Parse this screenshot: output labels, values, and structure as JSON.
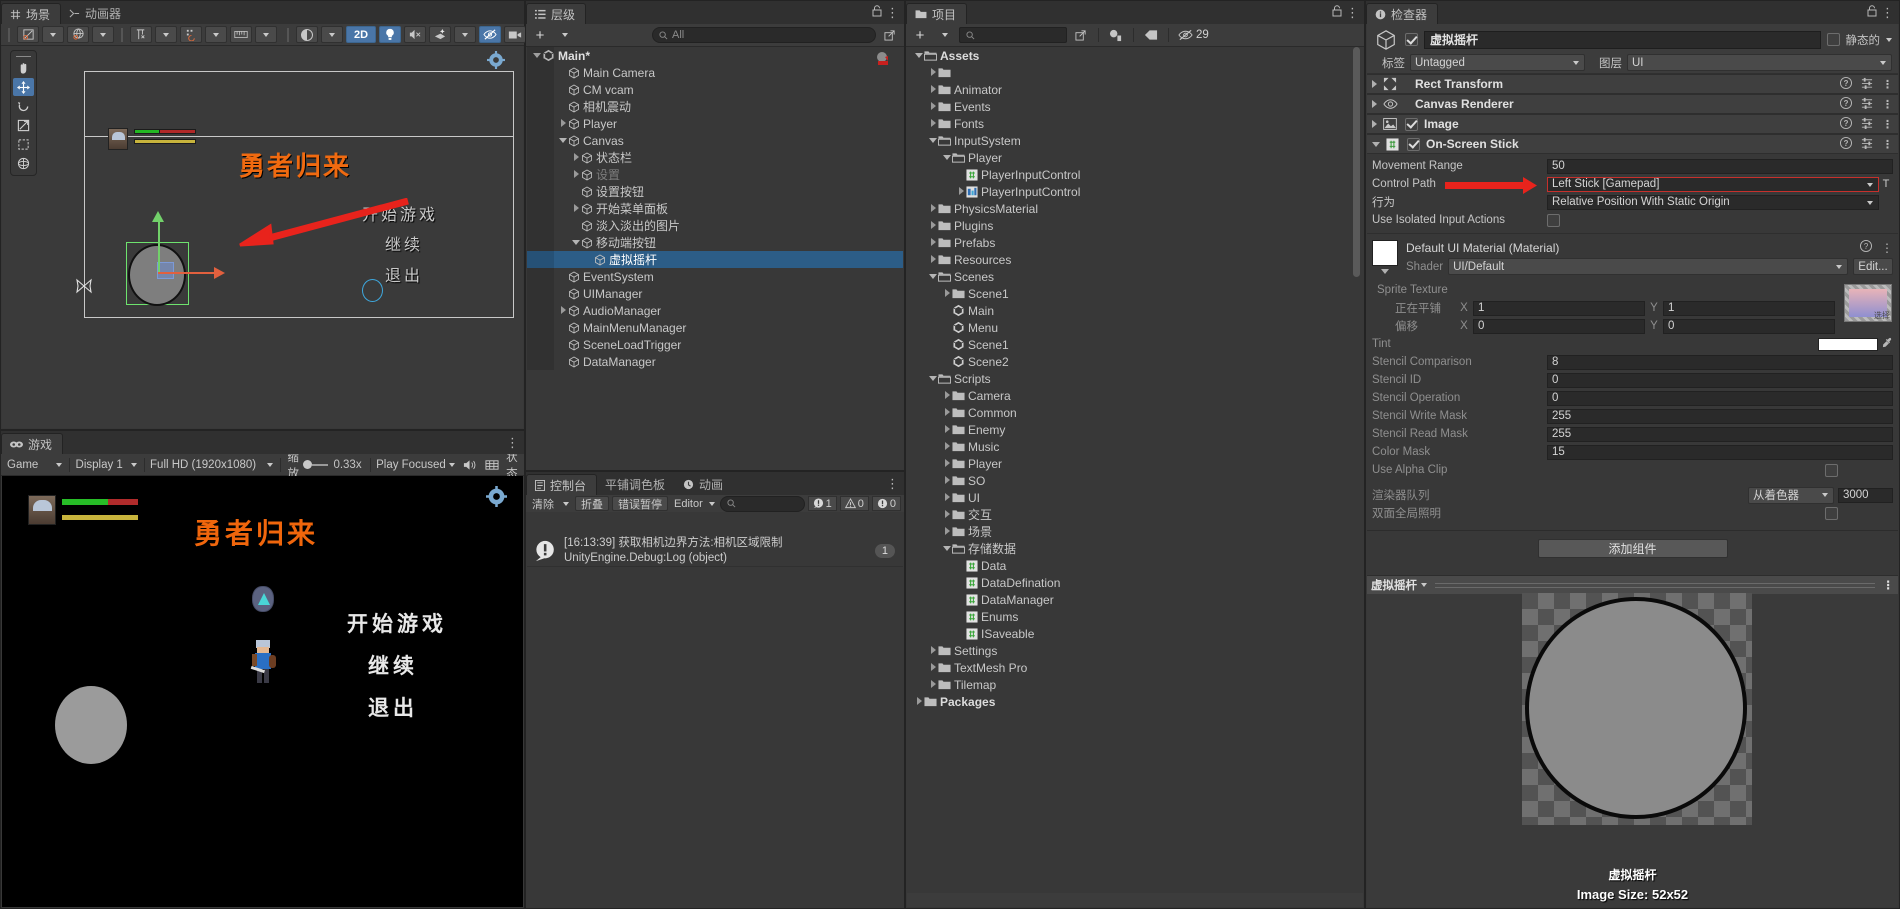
{
  "scene_panel": {
    "tabs": [
      {
        "label": "场景",
        "icon": "grid-icon",
        "active": true
      },
      {
        "label": "动画器",
        "icon": "animator-icon",
        "active": false
      }
    ],
    "toolbar": [
      {
        "name": "pivot-rotation-toggle",
        "icon": "pivot-icon",
        "dropdown": true,
        "on": false
      },
      {
        "name": "global-local-toggle",
        "icon": "globe-icon",
        "dropdown": true,
        "on": false
      },
      {
        "name": "grid-snap-toggle",
        "icon": "grid-snap-icon",
        "dropdown": true,
        "on": false
      },
      {
        "name": "vertex-snap-toggle",
        "icon": "vertex-snap-icon",
        "dropdown": true,
        "on": false
      },
      {
        "name": "ruler-icon",
        "icon": "ruler-icon",
        "dropdown": true,
        "on": false
      },
      {
        "name": "shading-mode",
        "icon": "shading-icon",
        "dropdown": true,
        "on": false
      },
      {
        "name": "2d-toggle",
        "label": "2D",
        "on": true
      },
      {
        "name": "lighting-toggle",
        "icon": "bulb-icon",
        "on": true
      },
      {
        "name": "audio-toggle",
        "icon": "mute-icon",
        "on": false
      },
      {
        "name": "effects-toggle",
        "icon": "fx-icon",
        "dropdown": true,
        "on": false
      },
      {
        "name": "hidden-objects-toggle",
        "icon": "eye-off-icon",
        "on": true
      },
      {
        "name": "camera-settings",
        "icon": "camera-icon",
        "dropdown": true,
        "on": false
      },
      {
        "name": "gizmos-toggle",
        "icon": "gizmo-icon",
        "dropdown": true,
        "on": true
      }
    ],
    "tools": [
      "hand-tool",
      "move-tool",
      "rotate-tool",
      "scale-tool",
      "rect-tool",
      "transform-tool"
    ],
    "selected_tool_index": 1,
    "game_title": "勇者归来",
    "menu_items": [
      "开始游戏",
      "继续",
      "退出"
    ]
  },
  "game_panel": {
    "tab": "游戏",
    "toolbar": {
      "mode": "Game",
      "display": "Display 1",
      "resolution": "Full HD (1920x1080)",
      "scale_label": "缩放",
      "scale_value": "0.33x",
      "play_mode": "Play Focused",
      "mute_icon": "speaker-icon",
      "stats_icon": "stats-icon",
      "gizmos_label": "状态"
    },
    "title": "勇者归来",
    "menu_items": [
      "开始游戏",
      "继续",
      "退出"
    ]
  },
  "hierarchy": {
    "tab": "层级",
    "add_label": "+",
    "search_placeholder": "All",
    "items": [
      {
        "label": "Main*",
        "depth": 0,
        "arrow": "down",
        "icon": "unity-icon",
        "bold": true,
        "selected": false,
        "dim": false
      },
      {
        "label": "Main Camera",
        "depth": 2,
        "arrow": "",
        "icon": "cube-icon",
        "selected": false,
        "dim": false
      },
      {
        "label": "CM vcam",
        "depth": 2,
        "arrow": "",
        "icon": "cube-icon",
        "selected": false,
        "dim": false
      },
      {
        "label": "相机震动",
        "depth": 2,
        "arrow": "",
        "icon": "cube-icon",
        "selected": false,
        "dim": false
      },
      {
        "label": "Player",
        "depth": 2,
        "arrow": "right",
        "icon": "cube-icon",
        "selected": false,
        "dim": false
      },
      {
        "label": "Canvas",
        "depth": 2,
        "arrow": "down",
        "icon": "cube-icon",
        "selected": false,
        "dim": false
      },
      {
        "label": "状态栏",
        "depth": 3,
        "arrow": "right",
        "icon": "cube-icon",
        "selected": false,
        "dim": false
      },
      {
        "label": "设置",
        "depth": 3,
        "arrow": "right",
        "icon": "cube-icon",
        "selected": false,
        "dim": true
      },
      {
        "label": "设置按钮",
        "depth": 3,
        "arrow": "",
        "icon": "cube-icon",
        "selected": false,
        "dim": false
      },
      {
        "label": "开始菜单面板",
        "depth": 3,
        "arrow": "right",
        "icon": "cube-icon",
        "selected": false,
        "dim": false
      },
      {
        "label": "淡入淡出的图片",
        "depth": 3,
        "arrow": "",
        "icon": "cube-icon",
        "selected": false,
        "dim": false
      },
      {
        "label": "移动端按钮",
        "depth": 3,
        "arrow": "down",
        "icon": "cube-icon",
        "selected": false,
        "dim": false
      },
      {
        "label": "虚拟摇杆",
        "depth": 4,
        "arrow": "",
        "icon": "cube-icon",
        "selected": true,
        "dim": false
      },
      {
        "label": "EventSystem",
        "depth": 2,
        "arrow": "",
        "icon": "cube-icon",
        "selected": false,
        "dim": false
      },
      {
        "label": "UIManager",
        "depth": 2,
        "arrow": "",
        "icon": "cube-icon",
        "selected": false,
        "dim": false
      },
      {
        "label": "AudioManager",
        "depth": 2,
        "arrow": "right",
        "icon": "cube-icon",
        "selected": false,
        "dim": false
      },
      {
        "label": "MainMenuManager",
        "depth": 2,
        "arrow": "",
        "icon": "cube-icon",
        "selected": false,
        "dim": false
      },
      {
        "label": "SceneLoadTrigger",
        "depth": 2,
        "arrow": "",
        "icon": "cube-icon",
        "selected": false,
        "dim": false
      },
      {
        "label": "DataManager",
        "depth": 2,
        "arrow": "",
        "icon": "cube-icon",
        "selected": false,
        "dim": false
      }
    ]
  },
  "console": {
    "tabs": [
      {
        "label": "控制台",
        "icon": "console-icon",
        "active": true
      },
      {
        "label": "平铺调色板",
        "icon": "",
        "active": false
      },
      {
        "label": "动画",
        "icon": "clock-icon",
        "active": false
      }
    ],
    "clear_label": "清除",
    "collapse_label": "折叠",
    "error_pause_label": "错误暂停",
    "editor_label": "Editor",
    "search_placeholder": "",
    "counts": {
      "error": "1",
      "warning": "0",
      "info": "0"
    },
    "log": {
      "line1": "[16:13:39] 获取相机边界方法:相机区域限制",
      "line2": "UnityEngine.Debug:Log (object)",
      "count": "1",
      "icon": "error-icon"
    }
  },
  "project": {
    "tab": "项目",
    "add_label": "+",
    "search_placeholder": "",
    "hidden_count": "29",
    "items": [
      {
        "label": "Assets",
        "depth": 0,
        "arrow": "down",
        "icon": "folder-open-icon",
        "bold": true
      },
      {
        "label": "",
        "depth": 1,
        "arrow": "right",
        "icon": "folder-icon",
        "bold": false
      },
      {
        "label": "Animator",
        "depth": 1,
        "arrow": "right",
        "icon": "folder-icon",
        "bold": false
      },
      {
        "label": "Events",
        "depth": 1,
        "arrow": "right",
        "icon": "folder-icon",
        "bold": false
      },
      {
        "label": "Fonts",
        "depth": 1,
        "arrow": "right",
        "icon": "folder-icon",
        "bold": false
      },
      {
        "label": "InputSystem",
        "depth": 1,
        "arrow": "down",
        "icon": "folder-open-icon",
        "bold": false
      },
      {
        "label": "Player",
        "depth": 2,
        "arrow": "down",
        "icon": "folder-open-icon",
        "bold": false
      },
      {
        "label": "PlayerInputControl",
        "depth": 3,
        "arrow": "",
        "icon": "cs-script-icon",
        "bold": false
      },
      {
        "label": "PlayerInputControl",
        "depth": 3,
        "arrow": "right",
        "icon": "inputactions-icon",
        "bold": false
      },
      {
        "label": "PhysicsMaterial",
        "depth": 1,
        "arrow": "right",
        "icon": "folder-icon",
        "bold": false
      },
      {
        "label": "Plugins",
        "depth": 1,
        "arrow": "right",
        "icon": "folder-icon",
        "bold": false
      },
      {
        "label": "Prefabs",
        "depth": 1,
        "arrow": "right",
        "icon": "folder-icon",
        "bold": false
      },
      {
        "label": "Resources",
        "depth": 1,
        "arrow": "right",
        "icon": "folder-icon",
        "bold": false
      },
      {
        "label": "Scenes",
        "depth": 1,
        "arrow": "down",
        "icon": "folder-open-icon",
        "bold": false
      },
      {
        "label": "Scene1",
        "depth": 2,
        "arrow": "right",
        "icon": "folder-icon",
        "bold": false
      },
      {
        "label": "Main",
        "depth": 2,
        "arrow": "",
        "icon": "unity-scene-icon",
        "bold": false
      },
      {
        "label": "Menu",
        "depth": 2,
        "arrow": "",
        "icon": "unity-scene-icon",
        "bold": false
      },
      {
        "label": "Scene1",
        "depth": 2,
        "arrow": "",
        "icon": "unity-scene-icon",
        "bold": false
      },
      {
        "label": "Scene2",
        "depth": 2,
        "arrow": "",
        "icon": "unity-scene-icon",
        "bold": false
      },
      {
        "label": "Scripts",
        "depth": 1,
        "arrow": "down",
        "icon": "folder-open-icon",
        "bold": false
      },
      {
        "label": "Camera",
        "depth": 2,
        "arrow": "right",
        "icon": "folder-icon",
        "bold": false
      },
      {
        "label": "Common",
        "depth": 2,
        "arrow": "right",
        "icon": "folder-icon",
        "bold": false
      },
      {
        "label": "Enemy",
        "depth": 2,
        "arrow": "right",
        "icon": "folder-icon",
        "bold": false
      },
      {
        "label": "Music",
        "depth": 2,
        "arrow": "right",
        "icon": "folder-icon",
        "bold": false
      },
      {
        "label": "Player",
        "depth": 2,
        "arrow": "right",
        "icon": "folder-icon",
        "bold": false
      },
      {
        "label": "SO",
        "depth": 2,
        "arrow": "right",
        "icon": "folder-icon",
        "bold": false
      },
      {
        "label": "UI",
        "depth": 2,
        "arrow": "right",
        "icon": "folder-icon",
        "bold": false
      },
      {
        "label": "交互",
        "depth": 2,
        "arrow": "right",
        "icon": "folder-icon",
        "bold": false
      },
      {
        "label": "场景",
        "depth": 2,
        "arrow": "right",
        "icon": "folder-icon",
        "bold": false
      },
      {
        "label": "存储数据",
        "depth": 2,
        "arrow": "down",
        "icon": "folder-open-icon",
        "bold": false
      },
      {
        "label": "Data",
        "depth": 3,
        "arrow": "",
        "icon": "cs-script-icon",
        "bold": false
      },
      {
        "label": "DataDefination",
        "depth": 3,
        "arrow": "",
        "icon": "cs-script-icon",
        "bold": false
      },
      {
        "label": "DataManager",
        "depth": 3,
        "arrow": "",
        "icon": "cs-script-icon",
        "bold": false
      },
      {
        "label": "Enums",
        "depth": 3,
        "arrow": "",
        "icon": "cs-script-icon",
        "bold": false
      },
      {
        "label": "ISaveable",
        "depth": 3,
        "arrow": "",
        "icon": "cs-script-icon",
        "bold": false
      },
      {
        "label": "Settings",
        "depth": 1,
        "arrow": "right",
        "icon": "folder-icon",
        "bold": false
      },
      {
        "label": "TextMesh Pro",
        "depth": 1,
        "arrow": "right",
        "icon": "folder-icon",
        "bold": false
      },
      {
        "label": "Tilemap",
        "depth": 1,
        "arrow": "right",
        "icon": "folder-icon",
        "bold": false
      },
      {
        "label": "Packages",
        "depth": 0,
        "arrow": "right",
        "icon": "folder-icon",
        "bold": true
      }
    ]
  },
  "inspector": {
    "tab": "检查器",
    "object_name": "虚拟摇杆",
    "enabled": true,
    "static_label": "静态的",
    "tag_label": "标签",
    "tag_value": "Untagged",
    "layer_label": "图层",
    "layer_value": "UI",
    "components": [
      {
        "name": "Rect Transform",
        "icon": "rect-transform-icon",
        "expanded": false,
        "has_checkbox": false
      },
      {
        "name": "Canvas Renderer",
        "icon": "eye-icon",
        "expanded": false,
        "has_checkbox": false
      },
      {
        "name": "Image",
        "icon": "image-icon",
        "expanded": false,
        "has_checkbox": true,
        "checked": true
      },
      {
        "name": "On-Screen Stick",
        "icon": "cs-script-icon",
        "expanded": true,
        "has_checkbox": true,
        "checked": true
      }
    ],
    "on_screen_stick": {
      "movement_range_label": "Movement Range",
      "movement_range_value": "50",
      "control_path_label": "Control Path",
      "control_path_value": "Left Stick [Gamepad]",
      "control_path_suffix": "T",
      "behaviour_label": "行为",
      "behaviour_value": "Relative Position With Static Origin",
      "isolated_label": "Use Isolated Input Actions",
      "isolated_checked": false
    },
    "material": {
      "title": "Default UI Material (Material)",
      "shader_label": "Shader",
      "shader_value": "UI/Default",
      "edit_label": "Edit...",
      "sprite_texture_label": "Sprite Texture",
      "tiling_label": "正在平铺",
      "tiling_x": "1",
      "tiling_y": "1",
      "offset_label": "偏移",
      "offset_x": "0",
      "offset_y": "0",
      "select_label": "选择",
      "rows": [
        {
          "label": "Tint",
          "value": "",
          "type": "color"
        },
        {
          "label": "Stencil Comparison",
          "value": "8",
          "type": "num"
        },
        {
          "label": "Stencil ID",
          "value": "0",
          "type": "num"
        },
        {
          "label": "Stencil Operation",
          "value": "0",
          "type": "num"
        },
        {
          "label": "Stencil Write Mask",
          "value": "255",
          "type": "num"
        },
        {
          "label": "Stencil Read Mask",
          "value": "255",
          "type": "num"
        },
        {
          "label": "Color Mask",
          "value": "15",
          "type": "num"
        },
        {
          "label": "Use Alpha Clip",
          "value": "",
          "type": "check"
        }
      ],
      "render_queue_label": "渲染器队列",
      "render_queue_mode": "从着色器",
      "render_queue_value": "3000",
      "double_sided_label": "双面全局照明"
    },
    "add_component_label": "添加组件",
    "preview": {
      "header": "虚拟摇杆",
      "name": "虚拟摇杆",
      "size": "Image Size: 52x52"
    }
  },
  "colors": {
    "accent_blue": "#2c5d87",
    "toggle_blue": "#4a76a8",
    "title_orange": "#f0660c",
    "arrow_red": "#e8231c",
    "panel_bg": "#383838",
    "header_bg": "#3c3c3c"
  }
}
